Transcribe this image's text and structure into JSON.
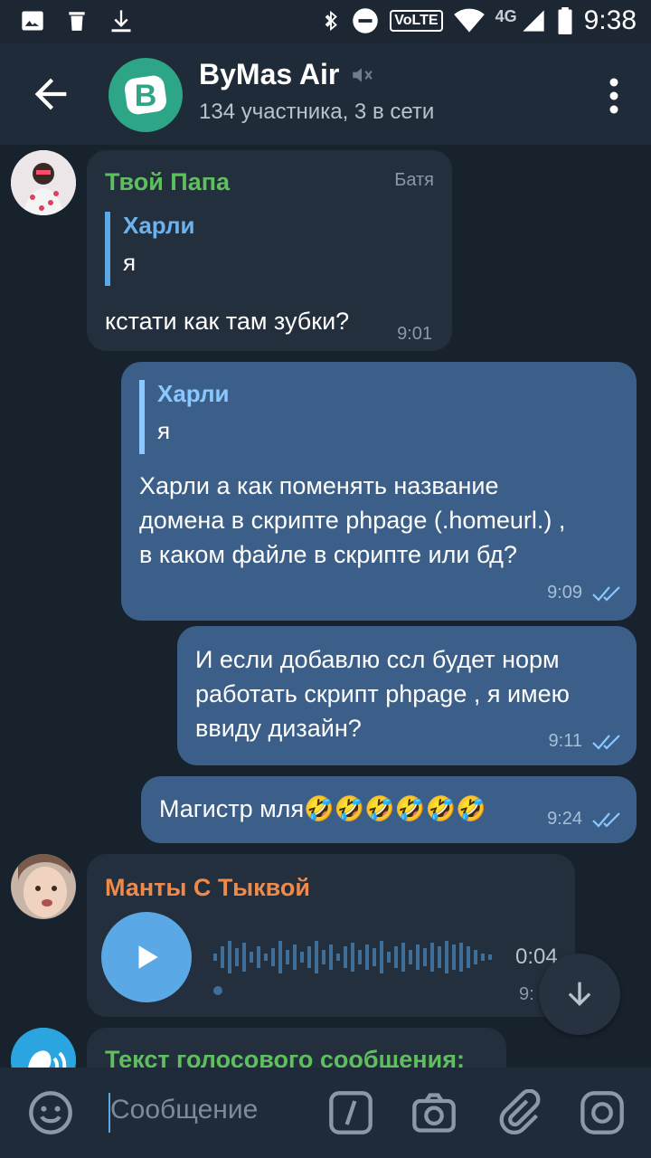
{
  "status_bar": {
    "time": "9:38",
    "volte": "VoLTE",
    "network": "4G"
  },
  "header": {
    "title": "ByMas Air",
    "subtitle": "134 участника, 3 в сети",
    "avatar_letter": "B"
  },
  "messages": [
    {
      "sender": "Твой Папа",
      "sender_tag": "Батя",
      "reply_name": "Харли",
      "reply_text": "я",
      "text": "кстати как там зубки?",
      "time": "9:01"
    },
    {
      "reply_name": "Харли",
      "reply_text": "я",
      "text_lines": [
        "Харли а как поменять название",
        "домена в скрипте phpage (.homeurl.) ,",
        "в каком файле в скрипте или бд?"
      ],
      "time": "9:09"
    },
    {
      "text_lines": [
        "И если добавлю ссл будет норм",
        "работать скрипт phpage , я имею",
        "ввиду дизайн?"
      ],
      "time": "9:11"
    },
    {
      "text": "Магистр мля🤣🤣🤣🤣🤣🤣",
      "time": "9:24"
    },
    {
      "sender": "Манты С Тыквой",
      "voice_duration": "0:04",
      "time": "9:"
    },
    {
      "sender": "Текст голосового сообщения:"
    }
  ],
  "input": {
    "placeholder": "Сообщение"
  },
  "colors": {
    "bg": "#18222d",
    "header": "#1f2b38",
    "bubble_in": "#232f3d",
    "bubble_out": "#3b5f88",
    "green_name": "#5fbf5f",
    "orange_name": "#f08a4b",
    "link_blue": "#5aa9e6"
  }
}
